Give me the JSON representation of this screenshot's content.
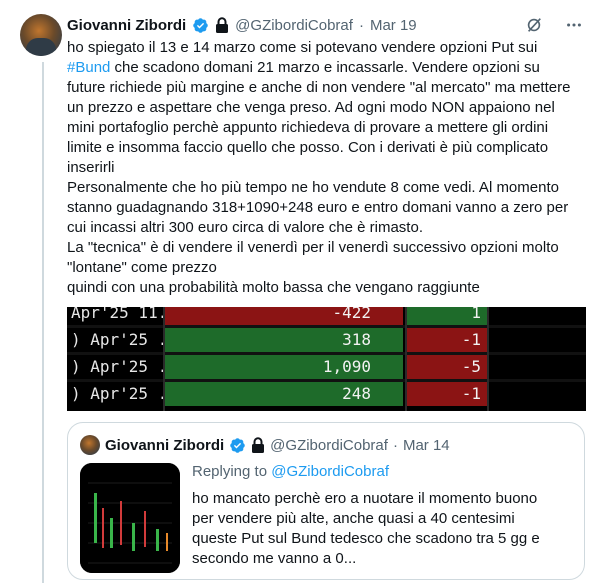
{
  "tweet": {
    "author_name": "Giovanni Zibordi",
    "handle": "@GZibordiCobraf",
    "separator": "·",
    "date": "Mar 19",
    "text_lines": [
      [
        "ho spiegato il 13 e 14 marzo come si potevano vendere opzioni Put sui"
      ],
      [
        "#Bund",
        " che scadono domani 21 marzo e incassarle. Vendere opzioni su"
      ],
      [
        "future richiede più margine e anche di non vendere \"al mercato\" ma mettere"
      ],
      [
        "un prezzo e aspettare che venga preso. Ad ogni modo NON appaiono nel"
      ],
      [
        "mini portafoglio perchè appunto richiedeva di provare a mettere gli ordini"
      ],
      [
        "limite e insomma faccio quello che posso. Con i derivati è più complicato"
      ],
      [
        "inserirli"
      ],
      [
        "Personalmente che ho più tempo ne ho vendute 8 come vedi. Al momento"
      ],
      [
        "stanno guadagnando 318+1090+248 euro e entro domani vanno a zero per"
      ],
      [
        "cui incassi altri 300 euro circa di valore che è rimasto."
      ],
      [
        "La \"tecnica\" è di vendere il venerdì per il venerdì successivo opzioni molto"
      ],
      [
        "\"lontane\" come prezzo"
      ],
      [
        "quindi con una probabilità molto bassa che vengano raggiunte"
      ]
    ],
    "hashtag": "#Bund",
    "hashtag_color": "#1d9bf0"
  },
  "positions_table": {
    "rows": [
      {
        "label": "Apr'25 11...",
        "pnl": "-422",
        "qty": "1",
        "pnl_color": "red",
        "qty_color": "green"
      },
      {
        "label": ") Apr'25 ...",
        "pnl": "318",
        "qty": "-1",
        "pnl_color": "green",
        "qty_color": "red"
      },
      {
        "label": ") Apr'25 ...",
        "pnl": "1,090",
        "qty": "-5",
        "pnl_color": "green",
        "qty_color": "red"
      },
      {
        "label": ") Apr'25 ...",
        "pnl": "248",
        "qty": "-1",
        "pnl_color": "green",
        "qty_color": "red"
      }
    ]
  },
  "quoted_tweet": {
    "author_name": "Giovanni Zibordi",
    "handle": "@GZibordiCobraf",
    "separator": "·",
    "date": "Mar 14",
    "replying_prefix": "Replying to ",
    "replying_to": "@GZibordiCobraf",
    "text_lines": [
      "ho mancato perchè ero a nuotare il momento buono",
      "per vendere più alte, anche quasi a 40 centesimi",
      "queste Put sul Bund tedesco che scadono tra 5 gg e",
      "secondo me vanno a 0..."
    ]
  },
  "icons": {
    "verified": "verified-badge-icon",
    "lock": "lock-icon",
    "grok": "grok-icon",
    "more": "more-icon"
  },
  "colors": {
    "accent": "#1d9bf0",
    "muted": "#536471",
    "table_green": "#1e6b2a",
    "table_red": "#8b1414"
  }
}
